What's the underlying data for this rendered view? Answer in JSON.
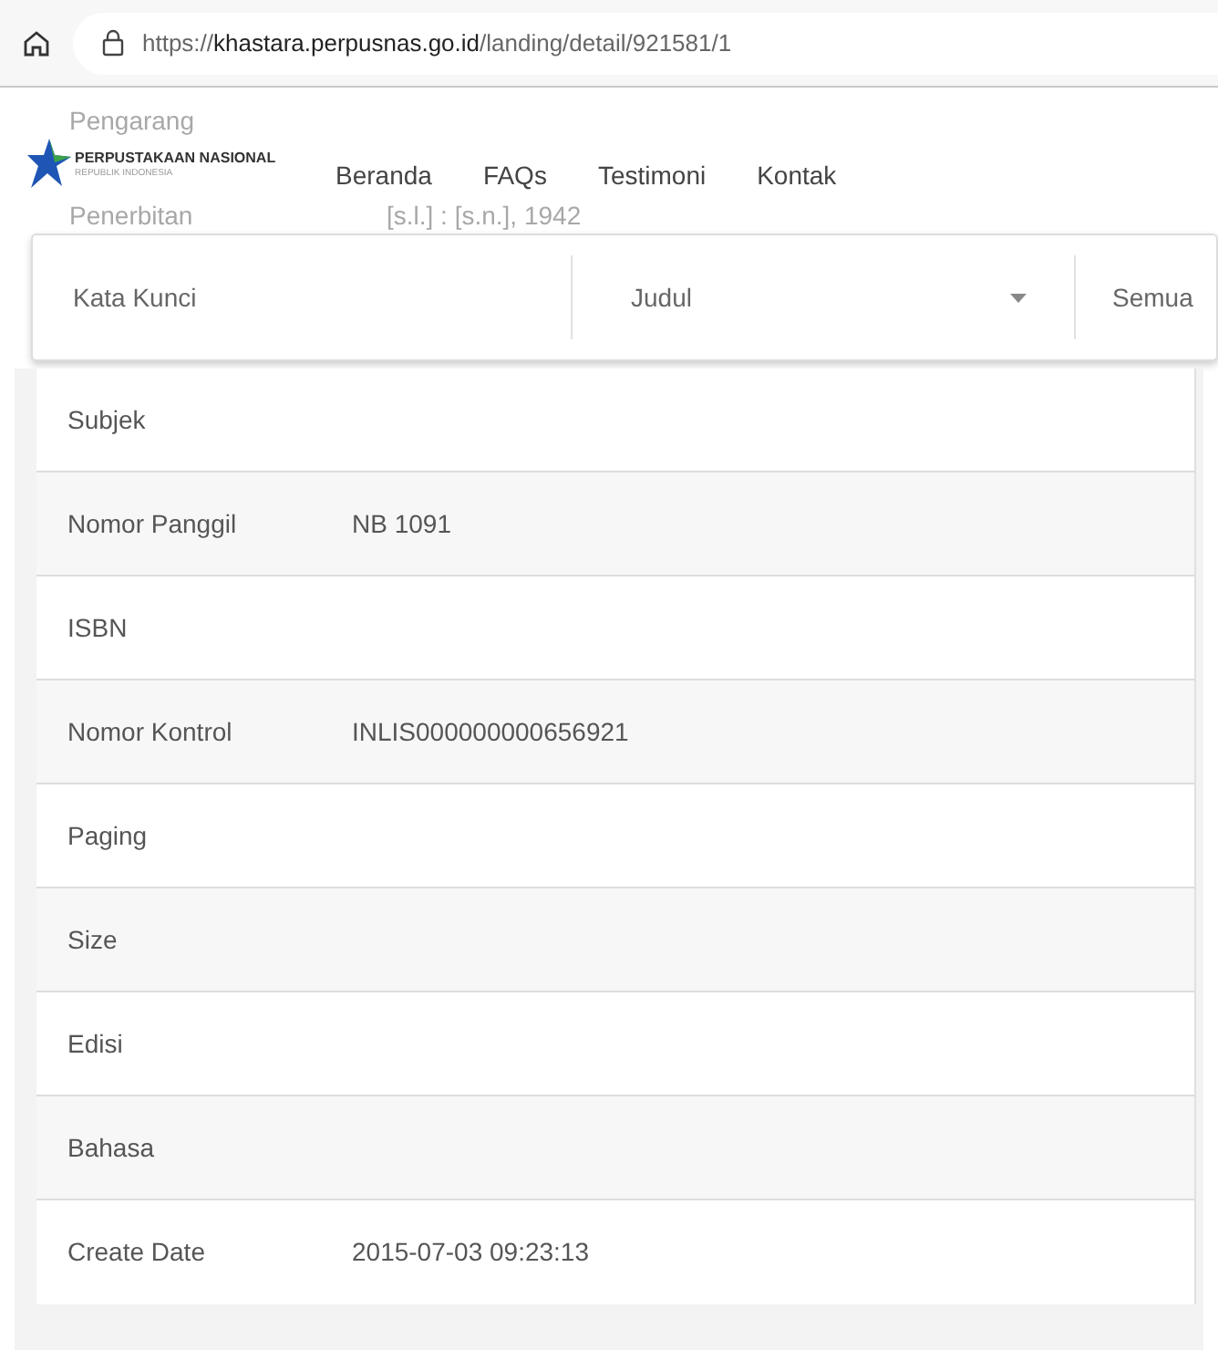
{
  "browser": {
    "url_scheme": "https://",
    "url_host": "khastara.perpusnas.go.id",
    "url_path": "/landing/detail/921581/1"
  },
  "background_rows": [
    {
      "label": "Pengarang"
    },
    {
      "label": "Penerbitan",
      "value": "[s.l.] : [s.n.], 1942"
    }
  ],
  "logo": {
    "title": "PERPUSTAKAAN NASIONAL",
    "subtitle": "REPUBLIK INDONESIA"
  },
  "nav": [
    "Beranda",
    "FAQs",
    "Testimoni",
    "Kontak"
  ],
  "search": {
    "placeholder": "Kata Kunci",
    "field": "Judul",
    "scope": "Semua"
  },
  "details": [
    {
      "label": "Subjek"
    },
    {
      "label": "Nomor Panggil",
      "value": "NB 1091"
    },
    {
      "label": "ISBN"
    },
    {
      "label": "Nomor Kontrol",
      "value": "INLIS000000000656921"
    },
    {
      "label": "Paging"
    },
    {
      "label": "Size"
    },
    {
      "label": "Edisi"
    },
    {
      "label": "Bahasa"
    },
    {
      "label": "Create Date",
      "value": "2015-07-03 09:23:13"
    }
  ]
}
